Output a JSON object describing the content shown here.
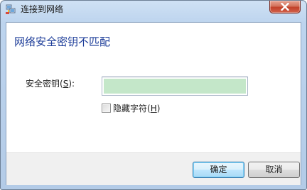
{
  "window": {
    "title": "连接到网络",
    "close_icon": "close-icon"
  },
  "dialog": {
    "heading": "网络安全密钥不匹配",
    "key_label_prefix": "安全密钥(",
    "key_label_accel": "S",
    "key_label_suffix": "):",
    "key_value": "",
    "key_fill_color": "#c4e7c9",
    "hide_chars_prefix": "隐藏字符(",
    "hide_chars_accel": "H",
    "hide_chars_suffix": ")",
    "hide_chars_checked": false
  },
  "footer": {
    "ok_label": "确定",
    "cancel_label": "取消"
  }
}
